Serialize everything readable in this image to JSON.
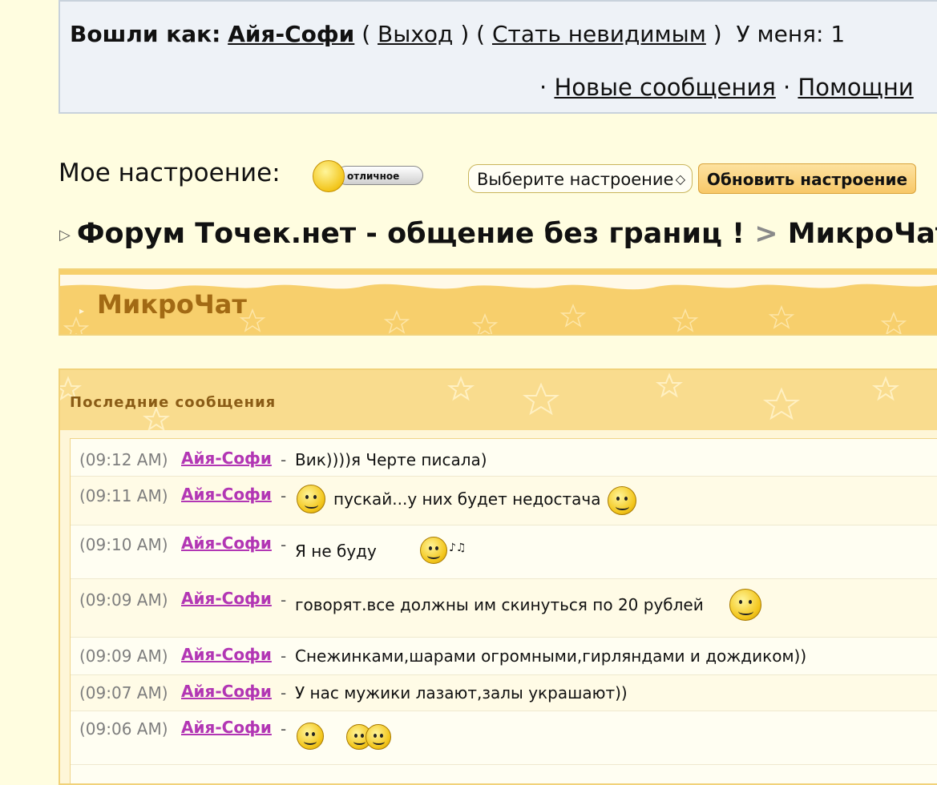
{
  "login": {
    "prefix": "Вошли как:",
    "username": "Айя-Софи",
    "open_paren_1": "(",
    "logout": "Выход",
    "close_open": ") (",
    "invisible": "Стать невидимым",
    "close_paren_2": ")",
    "my_label": "У меня: 1",
    "bullet1": "·",
    "new_messages": "Новые сообщения",
    "bullet2": "·",
    "helper": "Помощни"
  },
  "mood": {
    "label": "Мое настроение:",
    "badge_text": "отличное",
    "select_placeholder": "Выберите настроение",
    "update_button": "Обновить настроение"
  },
  "breadcrumb": {
    "forum": "Форум Точек.нет - общение без границ !",
    "separator": ">",
    "current": "МикроЧат"
  },
  "section": {
    "title": "МикроЧат"
  },
  "latest": {
    "header": "Последние сообщения",
    "messages": [
      {
        "time": "(09:12 AM)",
        "author": "Айя-Софи",
        "dash": "-",
        "text": "Вик))))я Черте писала)"
      },
      {
        "time": "(09:11 AM)",
        "author": "Айя-Софи",
        "dash": "-",
        "text": "пускай...у них будет недостача",
        "icons": [
          "dizzy-smiley-icon",
          "sleepy-smiley-icon"
        ]
      },
      {
        "time": "(09:10 AM)",
        "author": "Айя-Софи",
        "dash": "-",
        "text": "Я не буду",
        "icons": [
          "whistling-smiley-icon"
        ]
      },
      {
        "time": "(09:09 AM)",
        "author": "Айя-Софи",
        "dash": "-",
        "text": "говорят.все должны им скинуться по 20 рублей",
        "icons": [
          "grinning-girl-smiley-icon"
        ]
      },
      {
        "time": "(09:09 AM)",
        "author": "Айя-Софи",
        "dash": "-",
        "text": "Снежинками,шарами огромными,гирляндами и дождиком))"
      },
      {
        "time": "(09:07 AM)",
        "author": "Айя-Софи",
        "dash": "-",
        "text": "У нас мужики лазают,залы украшают))"
      },
      {
        "time": "(09:06 AM)",
        "author": "Айя-Софи",
        "dash": "-",
        "text": "",
        "icons": [
          "grin-smiley-icon",
          "couple-smileys-icon"
        ]
      }
    ]
  }
}
